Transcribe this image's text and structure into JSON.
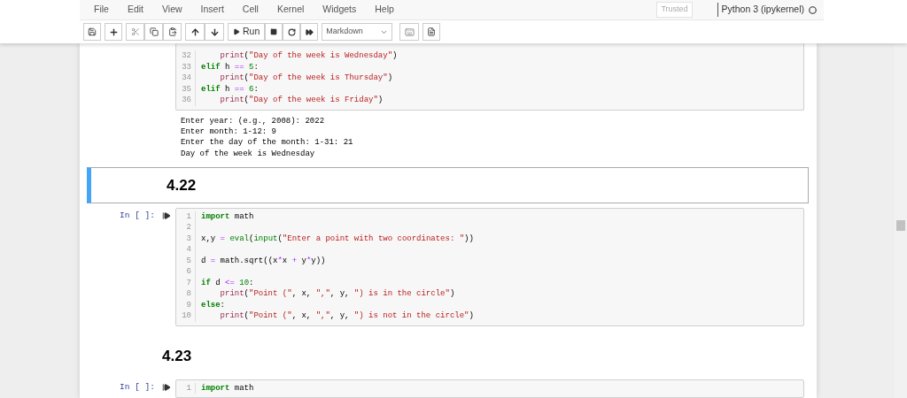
{
  "menu": [
    "File",
    "Edit",
    "View",
    "Insert",
    "Cell",
    "Kernel",
    "Widgets",
    "Help"
  ],
  "trusted": "Trusted",
  "kernel": "Python 3 (ipykernel)",
  "toolbar": {
    "run_label": "Run",
    "cell_type": "Markdown"
  },
  "cells": [
    {
      "kind": "code",
      "selected": false,
      "lines": [
        {
          "n": "32",
          "tokens": [
            {
              "kind": "fn",
              "text": "    print"
            },
            {
              "kind": "t",
              "text": "("
            },
            {
              "kind": "s",
              "text": "\"Day of the week is Wednesday\""
            },
            {
              "kind": "t",
              "text": ")"
            }
          ]
        },
        {
          "n": "33",
          "tokens": [
            {
              "kind": "kw",
              "text": "elif"
            },
            {
              "kind": "t",
              "text": " h "
            },
            {
              "kind": "op",
              "text": "=="
            },
            {
              "kind": "num",
              "text": " 5"
            },
            {
              "kind": "t",
              "text": ":"
            }
          ]
        },
        {
          "n": "34",
          "tokens": [
            {
              "kind": "fn",
              "text": "    print"
            },
            {
              "kind": "t",
              "text": "("
            },
            {
              "kind": "s",
              "text": "\"Day of the week is Thursday\""
            },
            {
              "kind": "t",
              "text": ")"
            }
          ]
        },
        {
          "n": "35",
          "tokens": [
            {
              "kind": "kw",
              "text": "elif"
            },
            {
              "kind": "t",
              "text": " h "
            },
            {
              "kind": "op",
              "text": "=="
            },
            {
              "kind": "num",
              "text": " 6"
            },
            {
              "kind": "t",
              "text": ":"
            }
          ]
        },
        {
          "n": "36",
          "tokens": [
            {
              "kind": "fn",
              "text": "    print"
            },
            {
              "kind": "t",
              "text": "("
            },
            {
              "kind": "s",
              "text": "\"Day of the week is Friday\""
            },
            {
              "kind": "t",
              "text": ")"
            }
          ]
        }
      ],
      "output": [
        "Enter year: (e.g., 2008): 2022",
        "Enter month: 1-12: 9",
        "Enter the day of the month: 1-31: 21",
        "Day of the week is Wednesday"
      ]
    },
    {
      "kind": "markdown",
      "selected": true,
      "heading": "4.22"
    },
    {
      "kind": "code",
      "selected": false,
      "prompt": "In [ ]:",
      "lines": [
        {
          "n": "1",
          "tokens": [
            {
              "kind": "kw",
              "text": "import"
            },
            {
              "kind": "t",
              "text": " math"
            }
          ]
        },
        {
          "n": "2"
        },
        {
          "n": "3",
          "tokens": [
            {
              "kind": "t",
              "text": "x,y "
            },
            {
              "kind": "op",
              "text": "="
            },
            {
              "kind": "bi",
              "text": " eval"
            },
            {
              "kind": "t",
              "text": "("
            },
            {
              "kind": "bi",
              "text": "input"
            },
            {
              "kind": "t",
              "text": "("
            },
            {
              "kind": "s",
              "text": "\"Enter a point with two coordinates: \""
            },
            {
              "kind": "t",
              "text": "))"
            }
          ]
        },
        {
          "n": "4"
        },
        {
          "n": "5",
          "tokens": [
            {
              "kind": "t",
              "text": "d "
            },
            {
              "kind": "op",
              "text": "="
            },
            {
              "kind": "t",
              "text": " math.sqrt((x"
            },
            {
              "kind": "op",
              "text": "*"
            },
            {
              "kind": "t",
              "text": "x "
            },
            {
              "kind": "op",
              "text": "+"
            },
            {
              "kind": "t",
              "text": " y"
            },
            {
              "kind": "op",
              "text": "*"
            },
            {
              "kind": "t",
              "text": "y))"
            }
          ]
        },
        {
          "n": "6"
        },
        {
          "n": "7",
          "tokens": [
            {
              "kind": "kw",
              "text": "if"
            },
            {
              "kind": "t",
              "text": " d "
            },
            {
              "kind": "op",
              "text": "<="
            },
            {
              "kind": "num",
              "text": " 10"
            },
            {
              "kind": "t",
              "text": ":"
            }
          ]
        },
        {
          "n": "8",
          "tokens": [
            {
              "kind": "fn",
              "text": "    print"
            },
            {
              "kind": "t",
              "text": "("
            },
            {
              "kind": "s",
              "text": "\"Point (\""
            },
            {
              "kind": "t",
              "text": ", x, "
            },
            {
              "kind": "s",
              "text": "\",\""
            },
            {
              "kind": "t",
              "text": ", y, "
            },
            {
              "kind": "s",
              "text": "\") is in the circle\""
            },
            {
              "kind": "t",
              "text": ")"
            }
          ]
        },
        {
          "n": "9",
          "tokens": [
            {
              "kind": "kw",
              "text": "else"
            },
            {
              "kind": "t",
              "text": ":"
            }
          ]
        },
        {
          "n": "10",
          "tokens": [
            {
              "kind": "fn",
              "text": "    print"
            },
            {
              "kind": "t",
              "text": "("
            },
            {
              "kind": "s",
              "text": "\"Point (\""
            },
            {
              "kind": "t",
              "text": ", x, "
            },
            {
              "kind": "s",
              "text": "\",\""
            },
            {
              "kind": "t",
              "text": ", y, "
            },
            {
              "kind": "s",
              "text": "\") is not in the circle\""
            },
            {
              "kind": "t",
              "text": ")"
            }
          ]
        }
      ]
    },
    {
      "kind": "markdown",
      "selected": false,
      "heading": "4.23"
    },
    {
      "kind": "code",
      "selected": false,
      "prompt": "In [ ]:",
      "lines": [
        {
          "n": "1",
          "tokens": [
            {
              "kind": "kw",
              "text": "import"
            },
            {
              "kind": "t",
              "text": " math"
            }
          ]
        }
      ]
    }
  ]
}
